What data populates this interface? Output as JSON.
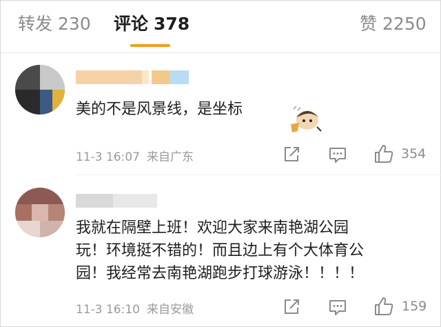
{
  "tabs": [
    {
      "label": "转发",
      "count": "230"
    },
    {
      "label": "评论",
      "count": "378"
    },
    {
      "label": "赞",
      "count": "2250"
    }
  ],
  "comments": [
    {
      "text_lines": [
        "美的不是风景线，是坐标"
      ],
      "date": "11-3 16:07",
      "source": "来自广东",
      "likes": "354"
    },
    {
      "text_lines": [
        "我就在隔壁上班！欢迎大家来南艳湖公园",
        "玩！环境挺不错的！而且边上有个大体育公",
        "园！我经常去南艳湖跑步打球游泳！！！！"
      ],
      "date": "11-3 16:10",
      "source": "来自安徽",
      "likes": "159"
    }
  ],
  "icons": {
    "share": "share-icon",
    "comment": "comment-icon",
    "like": "thumbs-up-icon"
  },
  "colors": {
    "accent": "#f59c1a",
    "muted": "#8a8a8a"
  }
}
